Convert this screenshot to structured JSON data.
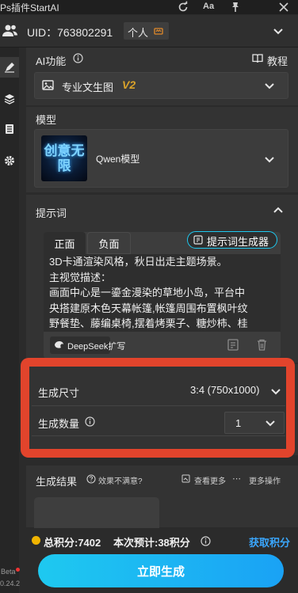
{
  "titlebar": {
    "title": "Ps插件StartAI",
    "icons": [
      "refresh-icon",
      "text-size-icon",
      "pin-icon",
      "close-icon"
    ],
    "font_size_label": "Aa"
  },
  "account": {
    "uid_label": "UID：763802291",
    "plan": "个人",
    "icons": [
      "users-icon",
      "crown-icon",
      "chevron-down-icon"
    ]
  },
  "rail": {
    "icons": [
      "brush-icon",
      "layers-icon",
      "library-icon",
      "settings-icon"
    ],
    "beta_label": "Beta",
    "version": "0.24.2"
  },
  "ai_function": {
    "title": "AI功能",
    "tutorial": "教程",
    "selected": "专业文生图",
    "version_badge": "V2"
  },
  "model": {
    "title": "模型",
    "name": "Qwen模型",
    "thumb_text": "创意无限"
  },
  "prompt": {
    "title": "提示词",
    "tabs": [
      "正面",
      "负面"
    ],
    "generator_button": "提示词生成器",
    "lines": [
      "3D卡通渲染风格，秋日出走主题场景。",
      "主视觉描述：",
      "画面中心是一鎏金漫染的草地小岛，平台中",
      "央搭建原木色天幕帐篷,帐篷周围布置枫叶纹",
      "野餐垫、藤编桌椅,摆着烤栗子、糖炒柿、桂"
    ],
    "deepseek_button": "DeepSeek扩写"
  },
  "generation": {
    "size_label": "生成尺寸",
    "size_value": "3:4 (750x1000)",
    "count_label": "生成数量",
    "count_value": "1"
  },
  "results": {
    "title": "生成结果",
    "feedback": "效果不满意?",
    "view_more": "查看更多",
    "more_actions": "更多操作"
  },
  "credits": {
    "total": "总积分:7402",
    "estimate": "本次预计:38积分",
    "get_credits": "获取积分"
  },
  "actions": {
    "generate": "立即生成"
  },
  "colors": {
    "accent": "#1ec9f0",
    "highlight_frame": "#e2442c",
    "badge_v2": "#d9a22a",
    "link_blue": "#3aa7ff"
  }
}
